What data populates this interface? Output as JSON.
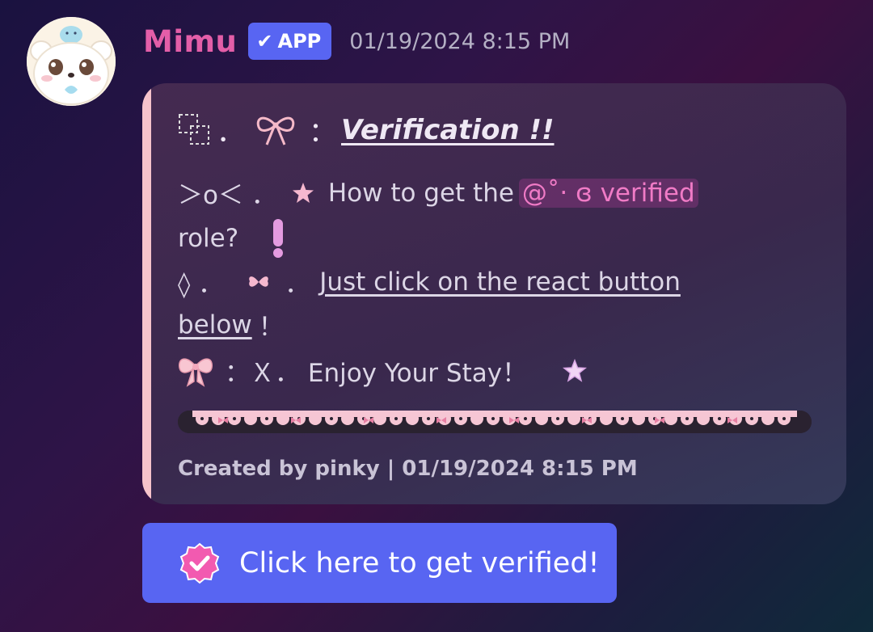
{
  "message": {
    "username": "Mimu",
    "badge_label": "APP",
    "timestamp": "01/19/2024 8:15 PM"
  },
  "embed": {
    "title_prefix": "．",
    "title_sep": "：",
    "title": "Verification !!",
    "line1_prefix": "＞o＜ ．",
    "line1_text": "How to get the",
    "mention": "@˚· ɞ verified",
    "line2_text": "role?",
    "line3_prefix": "◊ ．",
    "line3_dot": "．",
    "line3_link_part1": "Just click on the react button",
    "line4_link_part2": "below",
    "line4_suffix": "！",
    "line5_text": "：Ｘ．  Enjoy Your Stay！",
    "footer": "Created by pinky | 01/19/2024 8:15 PM",
    "accent_color": "#f6c3cb"
  },
  "button": {
    "label": "Click here to get verified!",
    "color": "#5865f2"
  }
}
